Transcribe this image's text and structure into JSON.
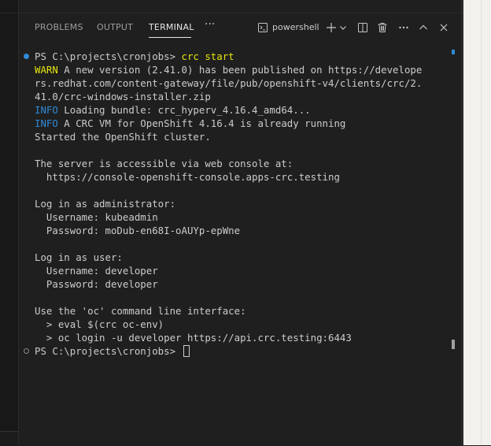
{
  "tabs": [
    {
      "label": "PROBLEMS"
    },
    {
      "label": "OUTPUT"
    },
    {
      "label": "TERMINAL"
    }
  ],
  "active_tab": "TERMINAL",
  "more_label": "···",
  "shell": {
    "label": "powershell"
  },
  "icons": {
    "shell": "terminal-icon",
    "add": "plus-icon",
    "dropdown": "chevron-down-icon",
    "split": "split-terminal-icon",
    "trash": "trash-icon",
    "more": "ellipsis-icon",
    "maximize": "chevron-up-icon",
    "close": "close-icon"
  },
  "colors": {
    "warn": "#e5e510",
    "info": "#2f8ad8",
    "text": "#cccccc",
    "background": "#1f1f1f"
  },
  "terminal": {
    "lines": [
      {
        "prompt": "PS C:\\projects\\cronjobs> ",
        "command": "crc start"
      },
      {
        "level": "WARN",
        "text": " A new version (2.41.0) has been published on https://develope"
      },
      {
        "text": "rs.redhat.com/content-gateway/file/pub/openshift-v4/clients/crc/2."
      },
      {
        "text": "41.0/crc-windows-installer.zip"
      },
      {
        "level": "INFO",
        "text": " Loading bundle: crc_hyperv_4.16.4_amd64..."
      },
      {
        "level": "INFO",
        "text": " A CRC VM for OpenShift 4.16.4 is already running"
      },
      {
        "text": "Started the OpenShift cluster."
      },
      {
        "text": ""
      },
      {
        "text": "The server is accessible via web console at:"
      },
      {
        "text": "  https://console-openshift-console.apps-crc.testing"
      },
      {
        "text": ""
      },
      {
        "text": "Log in as administrator:"
      },
      {
        "text": "  Username: kubeadmin"
      },
      {
        "text": "  Password: moDub-en68I-oAUYp-epWne"
      },
      {
        "text": ""
      },
      {
        "text": "Log in as user:"
      },
      {
        "text": "  Username: developer"
      },
      {
        "text": "  Password: developer"
      },
      {
        "text": ""
      },
      {
        "text": "Use the 'oc' command line interface:"
      },
      {
        "text": "  > eval $(crc oc-env)"
      },
      {
        "text": "  > oc login -u developer https://api.crc.testing:6443"
      },
      {
        "prompt": "PS C:\\projects\\cronjobs> ",
        "command": ""
      }
    ]
  }
}
